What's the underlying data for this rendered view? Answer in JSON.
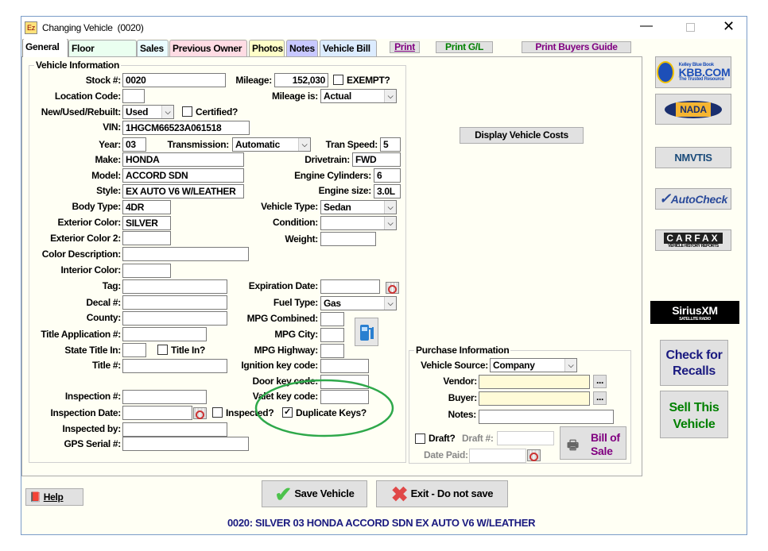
{
  "window": {
    "title": "Changing Vehicle  (0020)",
    "app_icon": "Ez"
  },
  "tabs": [
    {
      "label": "General",
      "color": "#ffffff"
    },
    {
      "label": "Floor Planning",
      "color": "#eafff0"
    },
    {
      "label": "Sales",
      "color": "#eafcff"
    },
    {
      "label": "Previous Owner",
      "color": "#ffdce4"
    },
    {
      "label": "Photos",
      "color": "#ffffc8"
    },
    {
      "label": "Notes",
      "color": "#c8c8ff"
    },
    {
      "label": "Vehicle Bill",
      "color": "#dcecff"
    }
  ],
  "print_buttons": {
    "print": "Print",
    "print_gl": "Print G/L",
    "print_buyers_guide": "Print Buyers Guide"
  },
  "vehicle_info": {
    "title": "Vehicle Information",
    "stock_label": "Stock #:",
    "stock": "0020",
    "mileage_label": "Mileage:",
    "mileage": "152,030",
    "exempt_label": "EXEMPT?",
    "exempt": false,
    "location_label": "Location Code:",
    "location": "",
    "mileage_is_label": "Mileage is:",
    "mileage_is": "Actual",
    "new_used_label": "New/Used/Rebuilt:",
    "new_used": "Used",
    "certified_label": "Certified?",
    "certified": false,
    "vin_label": "VIN:",
    "vin": "1HGCM66523A061518",
    "year_label": "Year:",
    "year": "03",
    "transmission_label": "Transmission:",
    "transmission": "Automatic",
    "tran_speed_label": "Tran Speed:",
    "tran_speed": "5",
    "make_label": "Make:",
    "make": "HONDA",
    "drivetrain_label": "Drivetrain:",
    "drivetrain": "FWD",
    "model_label": "Model:",
    "model": "ACCORD SDN",
    "engine_cyl_label": "Engine Cylinders:",
    "engine_cyl": "6",
    "style_label": "Style:",
    "style": "EX AUTO V6 W/LEATHER",
    "engine_size_label": "Engine size:",
    "engine_size": "3.0L",
    "body_type_label": "Body Type:",
    "body_type": "4DR",
    "vehicle_type_label": "Vehicle Type:",
    "vehicle_type": "Sedan",
    "ext_color_label": "Exterior Color:",
    "ext_color": "SILVER",
    "condition_label": "Condition:",
    "condition": "",
    "ext_color2_label": "Exterior Color 2:",
    "ext_color2": "",
    "weight_label": "Weight:",
    "weight": "",
    "color_desc_label": "Color Description:",
    "color_desc": "",
    "int_color_label": "Interior Color:",
    "int_color": "",
    "tag_label": "Tag:",
    "tag": "",
    "exp_date_label": "Expiration Date:",
    "exp_date": "",
    "decal_label": "Decal #:",
    "decal": "",
    "fuel_type_label": "Fuel Type:",
    "fuel_type": "Gas",
    "county_label": "County:",
    "county": "",
    "mpg_combined_label": "MPG Combined:",
    "mpg_combined": "",
    "title_app_label": "Title Application #:",
    "title_app": "",
    "mpg_city_label": "MPG City:",
    "mpg_city": "",
    "state_title_label": "State Title In:",
    "state_title": "",
    "title_in_label": "Title In?",
    "title_in": false,
    "mpg_hwy_label": "MPG Highway:",
    "mpg_hwy": "",
    "title_no_label": "Title #:",
    "title_no": "",
    "ignition_label": "Ignition key code:",
    "ignition": "",
    "door_label": "Door key code:",
    "door": "",
    "inspection_no_label": "Inspection #:",
    "inspection_no": "",
    "valet_label": "Valet key code:",
    "valet": "",
    "inspection_date_label": "Inspection Date:",
    "inspection_date": "",
    "inspected_label": "Inspected?",
    "inspected": false,
    "dup_keys_label": "Duplicate Keys?",
    "dup_keys": true,
    "inspected_by_label": "Inspected by:",
    "inspected_by": "",
    "gps_label": "GPS Serial #:",
    "gps": ""
  },
  "display_costs": "Display Vehicle Costs",
  "purchase": {
    "title": "Purchase Information",
    "source_label": "Vehicle Source:",
    "source": "Company",
    "vendor_label": "Vendor:",
    "vendor": "",
    "buyer_label": "Buyer:",
    "buyer": "",
    "notes_label": "Notes:",
    "notes": "",
    "browse": "...",
    "draft_label": "Draft?",
    "draft": false,
    "draft_no_label": "Draft #:",
    "draft_no": "",
    "date_paid_label": "Date Paid:",
    "date_paid": "",
    "bill_of_sale": "Bill of Sale"
  },
  "side": {
    "kbb": "KBB.COM",
    "kbb_top": "Kelley Blue Book",
    "kbb_sub": "The Trusted Resource",
    "nada": "NADA",
    "nmvtis": "NMVTIS",
    "autocheck": "AutoCheck",
    "carfax": "CARFAX",
    "carfax_sub": "VEHICLE HISTORY REPORTS",
    "sirius": "SiriusXM",
    "sirius_sub": "SATELLITE RADIO",
    "recalls": "Check for Recalls",
    "sell": "Sell This Vehicle"
  },
  "footer": {
    "help": "Help",
    "save": "Save Vehicle",
    "exit": "Exit - Do not save",
    "summary": "0020: SILVER 03 HONDA ACCORD SDN EX AUTO V6 W/LEATHER"
  },
  "colors": {
    "accent_blue": "#1a1a80",
    "green": "#008000",
    "purple": "#800080",
    "highlight_ellipse": "#2ea84a",
    "required_field": "#fffbd8"
  }
}
